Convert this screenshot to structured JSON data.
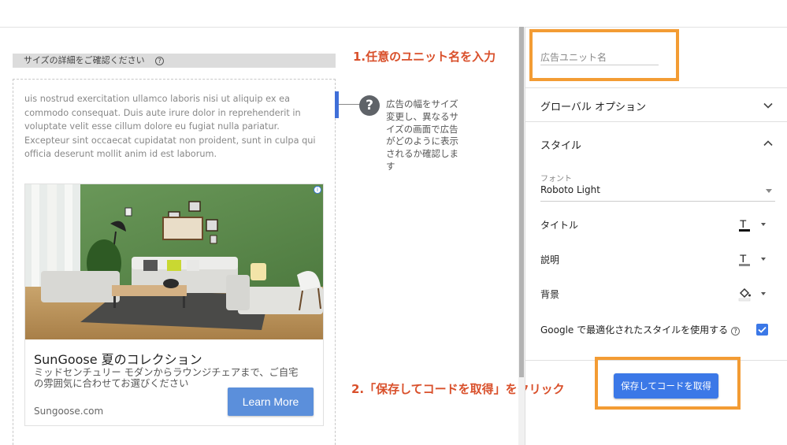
{
  "preview": {
    "size_details_label": "サイズの詳細をご確認ください",
    "help_glyph": "?",
    "lorem_text": "uis nostrud exercitation ullamco laboris nisi ut aliquip ex ea commodo consequat. Duis aute irure dolor in reprehenderit in voluptate velit esse cillum dolore eu fugiat nulla pariatur. Excepteur sint occaecat cupidatat non proident, sunt in culpa qui officia deserunt mollit anim id est laborum.",
    "ad": {
      "adchoices_glyph": "i",
      "headline": "SunGoose 夏のコレクション",
      "description": "ミッドセンチュリー モダンからラウンジチェアまで、ご自宅の雰囲気に合わせてお選びください",
      "domain": "Sungoose.com",
      "cta_label": "Learn More"
    },
    "tooltip_glyph": "?",
    "tooltip_text": "広告の幅をサイズ変更し、異なるサイズの画面で広告がどのように表示されるか確認します"
  },
  "annotations": {
    "step1": "1.任意のユニット名を入力",
    "step2": "2.「保存してコードを取得」をクリック",
    "highlight_color": "#f39c34",
    "note_color": "#d9502b"
  },
  "panel": {
    "unit_name_placeholder": "広告ユニット名",
    "global_options_label": "グローバル オプション",
    "style_label": "スタイル",
    "font_label": "フォント",
    "font_value": "Roboto Light",
    "title_label": "タイトル",
    "description_label": "説明",
    "background_label": "背景",
    "google_optimized_label": "Google で最適化されたスタイルを使用する",
    "google_optimized_checked": true,
    "save_button_label": "保存してコードを取得",
    "accent_color": "#3b78e7"
  }
}
